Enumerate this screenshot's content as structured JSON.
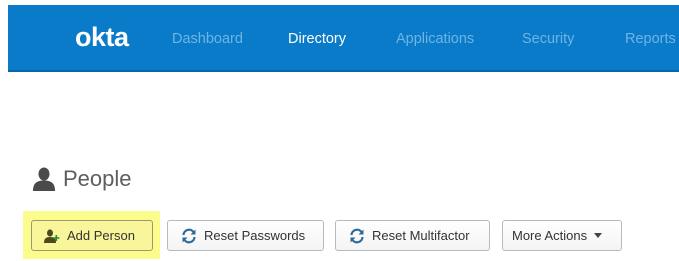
{
  "nav": {
    "logo": "okta",
    "items": [
      {
        "label": "Dashboard",
        "active": false
      },
      {
        "label": "Directory",
        "active": true
      },
      {
        "label": "Applications",
        "active": false
      },
      {
        "label": "Security",
        "active": false
      },
      {
        "label": "Reports",
        "active": false
      }
    ]
  },
  "page": {
    "title": "People",
    "title_icon": "person-icon"
  },
  "actions": {
    "add_person": {
      "label": "Add Person",
      "icon": "add-person-icon"
    },
    "reset_passwords": {
      "label": "Reset Passwords",
      "icon": "refresh-icon"
    },
    "reset_multifactor": {
      "label": "Reset Multifactor",
      "icon": "refresh-icon"
    },
    "more_actions": {
      "label": "More Actions",
      "icon": "caret-down-icon"
    }
  },
  "colors": {
    "navbar": "#0a7bc8",
    "nav_inactive": "#6fb4e6",
    "nav_active": "#ffffff",
    "highlight": "#fcfc8c"
  }
}
